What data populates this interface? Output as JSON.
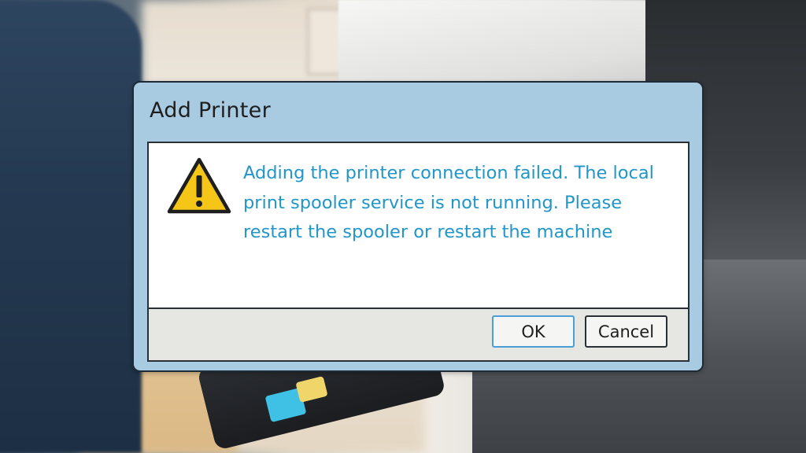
{
  "dialog": {
    "title": "Add Printer",
    "message": "Adding the printer connection failed. The local print spooler service is not running. Please restart the spooler or restart the machine",
    "icon": "warning-icon",
    "buttons": {
      "ok_label": "OK",
      "cancel_label": "Cancel"
    }
  },
  "colors": {
    "dialog_frame": "#a9cbe2",
    "message_text": "#2196c9",
    "warning_fill": "#f5c518",
    "ok_focus_border": "#4aa0d6"
  }
}
